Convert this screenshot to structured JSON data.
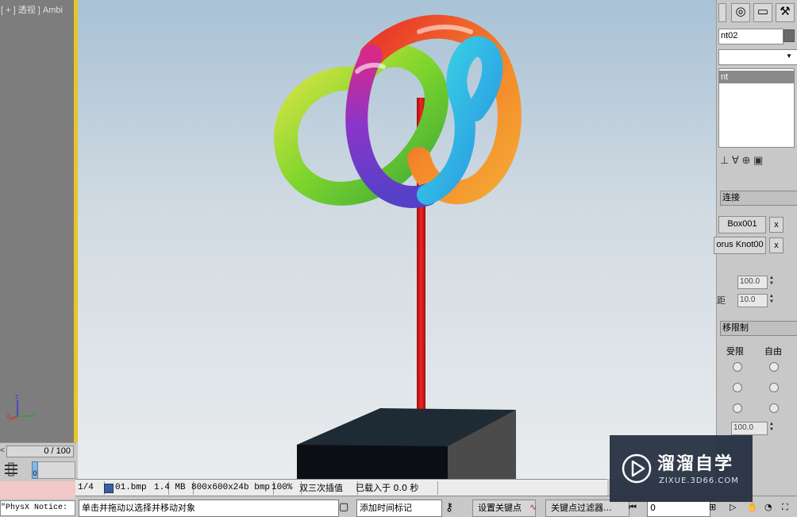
{
  "viewport": {
    "label": "[ + ] 透视 ] Ambi",
    "axis_x": "x",
    "axis_y": "y",
    "axis_z": "z"
  },
  "timeslider": {
    "frame": "0 / 100",
    "arrow": "<"
  },
  "trackbar": {
    "marker": "0"
  },
  "notice": "\"PhysX Notice:",
  "render_status": {
    "fields": [
      "1/4",
      "01.bmp",
      "1.4 MB",
      "800x600x24b bmp",
      "100%",
      "双三次插值",
      "已载入于 0.0 秒"
    ]
  },
  "bottom_bar": {
    "prompt": "单击并拖动以选择并移动对象",
    "add_time_tag": "添加时间标记",
    "set_key": "设置关键点",
    "key_filters": "关键点过滤器...",
    "frame_value": "0"
  },
  "cmd_panel": {
    "name_field": "nt02",
    "list_item": "nt",
    "section_link": "连接",
    "obj1": "Box001",
    "obj2": "orus Knot00",
    "remove": "x",
    "spinner1": "100.0",
    "spinner2_label": "距",
    "spinner2": "10.0",
    "section_limit": "移限制",
    "col_limited": "受限",
    "col_free": "自由",
    "spinner3": "100.0"
  },
  "watermark": {
    "title": "溜溜自学",
    "url": "ZIXUE.3D66.COM"
  },
  "colors": {
    "viewport_border": "#e6c629",
    "sky_top": "#a8c2d6",
    "sky_bottom": "#e9ecee",
    "pole": "#d41a1a",
    "logo_bg": "#232d40"
  }
}
